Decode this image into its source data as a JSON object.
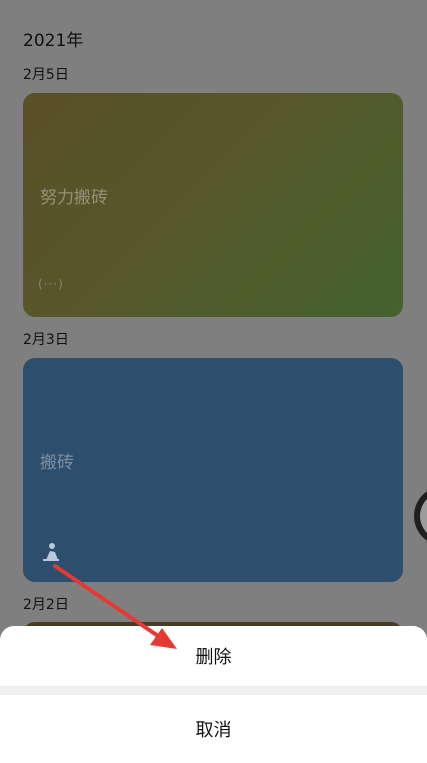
{
  "header": {
    "year": "2021年"
  },
  "sections": [
    {
      "date": "2月5日",
      "card": {
        "title": "努力搬砖",
        "footer": "(···)"
      }
    },
    {
      "date": "2月3日",
      "card": {
        "title": "搬砖"
      }
    },
    {
      "date": "2月2日"
    }
  ],
  "action_sheet": {
    "delete_label": "删除",
    "cancel_label": "取消"
  },
  "colors": {
    "overlay_bg": "#7f7f7f",
    "card1_start": "#5a4f26",
    "card1_end": "#44622f",
    "card2": "#2e4e6e",
    "arrow": "#e53935"
  },
  "icons": {
    "card2_mood": "mood-figure-icon"
  }
}
